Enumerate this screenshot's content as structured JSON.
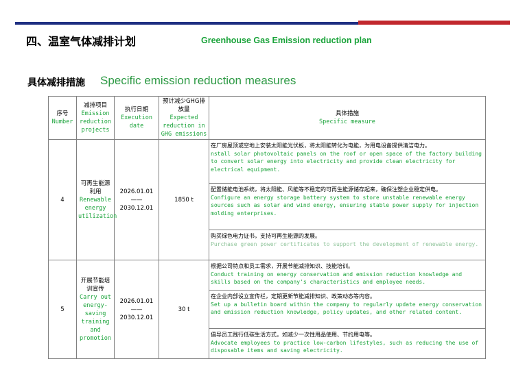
{
  "header": {
    "title_cn": "四、温室气体减排计划",
    "title_en": "Greenhouse Gas Emission reduction plan",
    "subtitle_cn": "具体减排措施",
    "subtitle_en": "Specific emission reduction measures"
  },
  "colors": {
    "accent_green": "#1aa33a",
    "bar_blue": "#1f2f82",
    "bar_red": "#c1272d"
  },
  "table": {
    "headers": {
      "no_cn": "序号",
      "no_en": "Number",
      "item_cn": "减排项目",
      "item_en": "Emission reduction projects",
      "date_cn": "执行日期",
      "date_en": "Execution date",
      "ghg_cn": "预计减少GHG排放量",
      "ghg_en": "Expected reduction in GHG emissions",
      "measure_cn": "具体措施",
      "measure_en": "Specific measure"
    },
    "rows": [
      {
        "number": "4",
        "item_cn": "可再生能源利用",
        "item_en": "Renewable energy utilization",
        "date": "2026.01.01——2030.12.01",
        "ghg": "1850 t",
        "measures": [
          {
            "cn": "在厂房屋顶或空地上安装太阳能光伏板，将太阳能转化为电能，为用电设备提供清洁电力。",
            "en": "nstall solar photovoltaic panels on the roof or open space of the factory building to convert solar energy into electricity and provide clean electricity for electrical equipment."
          },
          {
            "cn": "配置储能电池系统，将太阳能、风能等不稳定的可再生能源储存起来，确保注塑企业稳定供电。",
            "en": "Configure an energy storage battery system to store unstable renewable energy sources such as solar and wind energy, ensuring stable power supply for injection molding enterprises."
          },
          {
            "cn": "购买绿色电力证书，支持可再生能源的发展。",
            "en": "Purchase green power certificates to support the development of renewable energy."
          }
        ]
      },
      {
        "number": "5",
        "item_cn": "开展节能培训宣传",
        "item_en": "Carry out energy-saving training and promotion",
        "date": "2026.01.01——2030.12.01",
        "ghg": "30 t",
        "measures": [
          {
            "cn": "根据公司特点和员工需求，开展节能减排知识、技能培训。",
            "en": "Conduct training on energy conservation and emission reduction knowledge and skills based on the company's characteristics and employee needs."
          },
          {
            "cn": "在企业内部设立宣传栏，定期更新节能减排知识、政策动态等内容。",
            "en": "Set up a bulletin board within the company to regularly update energy conservation and emission reduction knowledge, policy updates, and other related content."
          },
          {
            "cn": "倡导员工践行低碳生活方式，如减少一次性用品使用、节约用电等。",
            "en": "Advocate employees to practice low-carbon lifestyles, such as reducing the use of disposable items and saving electricity."
          }
        ]
      }
    ]
  }
}
